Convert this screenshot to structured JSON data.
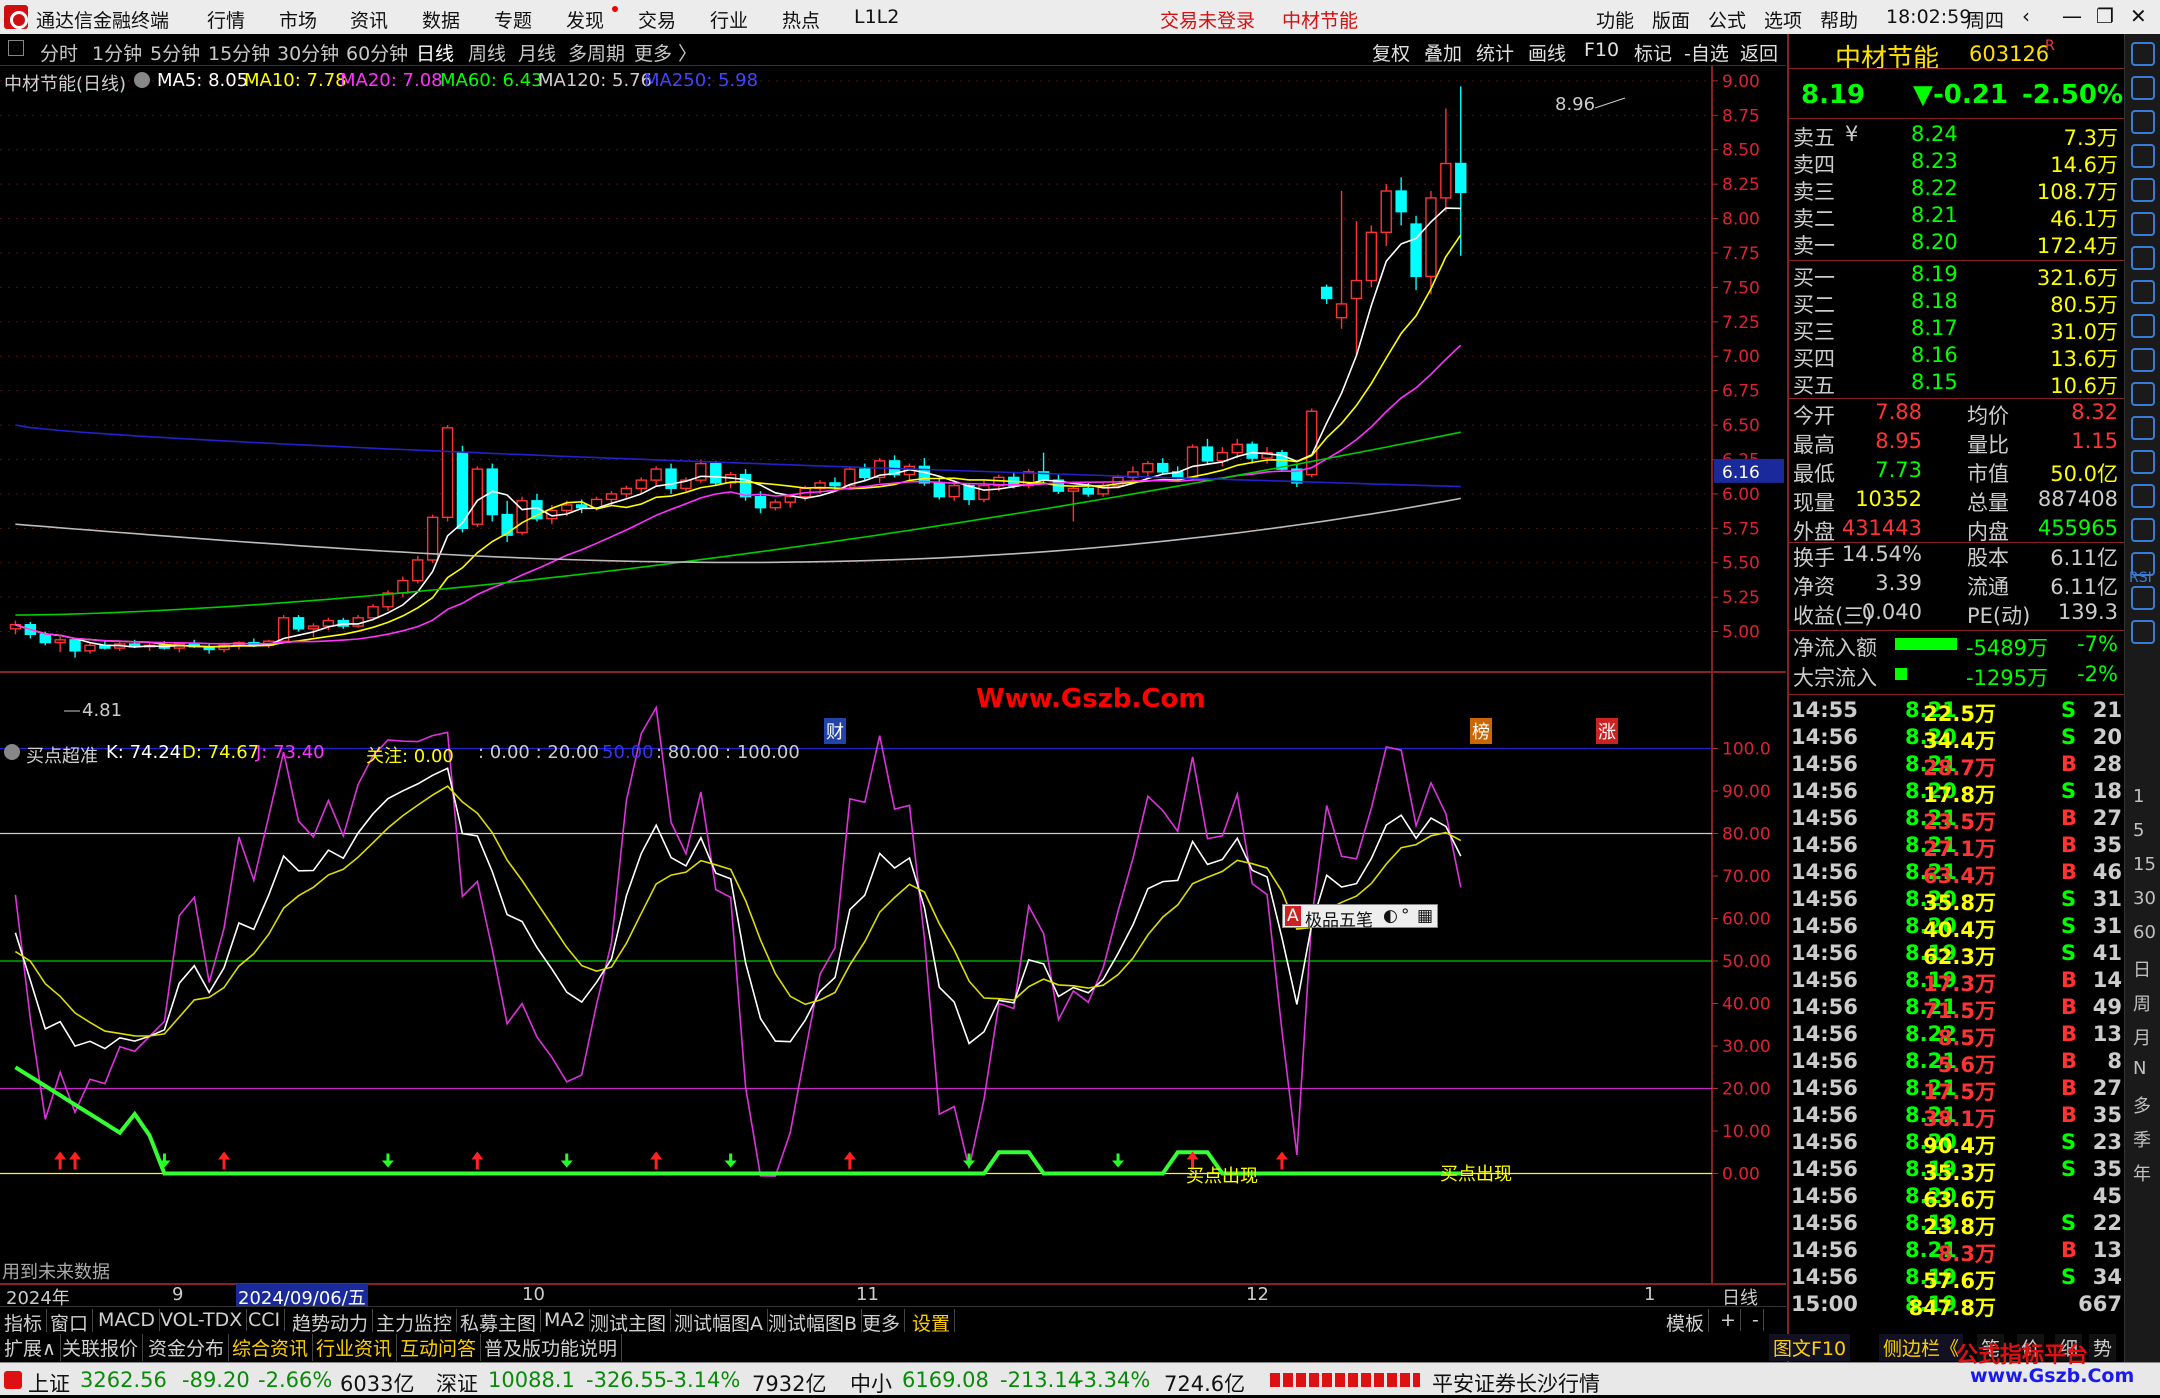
{
  "titlebar": {
    "app_title": "通达信金融终端",
    "menus": [
      "行情",
      "市场",
      "资讯",
      "数据",
      "专题",
      "发现",
      "交易",
      "行业",
      "热点",
      "L1L2"
    ],
    "login": "交易未登录",
    "stock": "中材节能",
    "right_menus": [
      "功能",
      "版面",
      "公式",
      "选项",
      "帮助"
    ],
    "time": "18:02:59",
    "weekday": "周四"
  },
  "toolbar": {
    "periods": [
      "分时",
      "1分钟",
      "5分钟",
      "15分钟",
      "30分钟",
      "60分钟",
      "日线",
      "周线",
      "月线",
      "多周期",
      "更多"
    ],
    "selected": "日线",
    "right": [
      "复权",
      "叠加",
      "统计",
      "画线",
      "F10",
      "标记",
      "-自选",
      "返回"
    ]
  },
  "main_chart": {
    "stock_period": "中材节能(日线)",
    "ma": [
      {
        "label": "MA5: 8.05",
        "color": "#ffffff"
      },
      {
        "label": "MA10: 7.78",
        "color": "#ffff00"
      },
      {
        "label": "MA20: 7.08",
        "color": "#ff33ff"
      },
      {
        "label": "MA60: 6.43",
        "color": "#00ff00"
      },
      {
        "label": "MA120: 5.76",
        "color": "#c0c0c0"
      },
      {
        "label": "MA250: 5.98",
        "color": "#3333ff"
      }
    ],
    "y_ticks": [
      "9.00",
      "8.75",
      "8.50",
      "8.25",
      "8.00",
      "7.75",
      "7.50",
      "7.25",
      "7.00",
      "6.75",
      "6.50",
      "6.25",
      "6.00",
      "5.75",
      "5.50",
      "5.25",
      "5.00"
    ],
    "high_label": "8.96",
    "low_label": "4.81",
    "current_price_tag": "6.16",
    "watermark": "Www.Gszb.Com",
    "markers": [
      "财",
      "榜",
      "涨"
    ]
  },
  "indicator": {
    "name": "买点超准",
    "k": "K: 74.24",
    "d": "D: 74.67",
    "j": "J: 73.40",
    "focus": "关注: 0.00",
    "levels": ": 0.00 : 20.00",
    "level50": "50.00",
    "levels2": ": 80.00 : 100.00",
    "y_ticks": [
      "100.0",
      "90.00",
      "80.00",
      "70.00",
      "60.00",
      "50.00",
      "40.00",
      "30.00",
      "20.00",
      "10.00",
      "0.00"
    ],
    "buy_signal": "买点出现",
    "popup_label": "极品五笔",
    "note": "用到未来数据"
  },
  "x_axis": {
    "labels": [
      "2024年",
      "9",
      "2024/09/06/五",
      "10",
      "11",
      "12",
      "1"
    ],
    "period": "日线"
  },
  "tabs_row1": [
    "指标",
    "窗口",
    "MACD",
    "VOL-TDX",
    "CCI",
    "趋势动力",
    "主力监控",
    "私募主图",
    "MA2",
    "测试主图",
    "测试幅图A",
    "测试幅图B",
    "更多",
    "设置"
  ],
  "tabs_row1_right": [
    "模板",
    "+",
    "-"
  ],
  "tabs_row2": [
    "扩展∧",
    "关联报价",
    "资金分布",
    "综合资讯",
    "行业资讯",
    "互动问答",
    "普及版功能说明"
  ],
  "panel": {
    "name": "中材节能",
    "code": "603126",
    "suffix": "R",
    "price": "8.19",
    "change": "▼-0.21",
    "change_pct": "-2.50%",
    "asks": [
      {
        "label": "卖五",
        "flag": "¥",
        "price": "8.24",
        "vol": "7.3万"
      },
      {
        "label": "卖四",
        "flag": "",
        "price": "8.23",
        "vol": "14.6万"
      },
      {
        "label": "卖三",
        "flag": "",
        "price": "8.22",
        "vol": "108.7万"
      },
      {
        "label": "卖二",
        "flag": "",
        "price": "8.21",
        "vol": "46.1万"
      },
      {
        "label": "卖一",
        "flag": "",
        "price": "8.20",
        "vol": "172.4万"
      }
    ],
    "bids": [
      {
        "label": "买一",
        "price": "8.19",
        "vol": "321.6万"
      },
      {
        "label": "买二",
        "price": "8.18",
        "vol": "80.5万"
      },
      {
        "label": "买三",
        "price": "8.17",
        "vol": "31.0万"
      },
      {
        "label": "买四",
        "price": "8.16",
        "vol": "13.6万"
      },
      {
        "label": "买五",
        "price": "8.15",
        "vol": "10.6万"
      }
    ],
    "stats1": [
      {
        "a": "今开",
        "b": "7.88",
        "c": "均价",
        "d": "8.32"
      },
      {
        "a": "最高",
        "b": "8.95",
        "c": "量比",
        "d": "1.15"
      },
      {
        "a": "最低",
        "b": "7.73",
        "c": "市值",
        "d": "50.0亿"
      },
      {
        "a": "现量",
        "b": "10352",
        "c": "总量",
        "d": "887408"
      },
      {
        "a": "外盘",
        "b": "431443",
        "c": "内盘",
        "d": "455965"
      }
    ],
    "stats2": [
      {
        "a": "换手",
        "b": "14.54%",
        "c": "股本",
        "d": "6.11亿"
      },
      {
        "a": "净资",
        "b": "3.39",
        "c": "流通",
        "d": "6.11亿"
      },
      {
        "a": "收益(三)",
        "b": "0.040",
        "c": "PE(动)",
        "d": "139.3"
      }
    ],
    "flows": [
      {
        "label": "净流入额",
        "value": "-5489万",
        "pct": "-7%",
        "bar": 0.62
      },
      {
        "label": "大宗流入",
        "value": "-1295万",
        "pct": "-2%",
        "bar": 0.12
      }
    ],
    "ticks": [
      {
        "t": "14:55",
        "p": "8.21",
        "v": "22.5万",
        "s": "S",
        "n": "21"
      },
      {
        "t": "14:56",
        "p": "8.20",
        "v": "34.4万",
        "s": "S",
        "n": "20"
      },
      {
        "t": "14:56",
        "p": "8.21",
        "v": "28.7万",
        "s": "B",
        "n": "28"
      },
      {
        "t": "14:56",
        "p": "8.20",
        "v": "17.8万",
        "s": "S",
        "n": "18"
      },
      {
        "t": "14:56",
        "p": "8.21",
        "v": "23.5万",
        "s": "B",
        "n": "27"
      },
      {
        "t": "14:56",
        "p": "8.21",
        "v": "27.1万",
        "s": "B",
        "n": "35"
      },
      {
        "t": "14:56",
        "p": "8.21",
        "v": "63.4万",
        "s": "B",
        "n": "46"
      },
      {
        "t": "14:56",
        "p": "8.20",
        "v": "35.8万",
        "s": "S",
        "n": "31"
      },
      {
        "t": "14:56",
        "p": "8.20",
        "v": "40.4万",
        "s": "S",
        "n": "31"
      },
      {
        "t": "14:56",
        "p": "8.19",
        "v": "62.3万",
        "s": "S",
        "n": "41"
      },
      {
        "t": "14:56",
        "p": "8.19",
        "v": "17.3万",
        "s": "B",
        "n": "14"
      },
      {
        "t": "14:56",
        "p": "8.21",
        "v": "71.5万",
        "s": "B",
        "n": "49"
      },
      {
        "t": "14:56",
        "p": "8.22",
        "v": "8.5万",
        "s": "B",
        "n": "13"
      },
      {
        "t": "14:56",
        "p": "8.21",
        "v": "5.6万",
        "s": "B",
        "n": "8"
      },
      {
        "t": "14:56",
        "p": "8.21",
        "v": "17.5万",
        "s": "B",
        "n": "27"
      },
      {
        "t": "14:56",
        "p": "8.21",
        "v": "38.1万",
        "s": "B",
        "n": "35"
      },
      {
        "t": "14:56",
        "p": "8.20",
        "v": "90.4万",
        "s": "S",
        "n": "23"
      },
      {
        "t": "14:56",
        "p": "8.19",
        "v": "35.3万",
        "s": "S",
        "n": "35"
      },
      {
        "t": "14:56",
        "p": "8.20",
        "v": "63.6万",
        "s": "",
        "n": "45"
      },
      {
        "t": "14:56",
        "p": "8.19",
        "v": "23.8万",
        "s": "S",
        "n": "22"
      },
      {
        "t": "14:56",
        "p": "8.21",
        "v": "8.3万",
        "s": "B",
        "n": "13"
      },
      {
        "t": "14:56",
        "p": "8.19",
        "v": "57.6万",
        "s": "S",
        "n": "34"
      },
      {
        "t": "15:00",
        "p": "8.19",
        "v": "847.8万",
        "s": "",
        "n": "667"
      }
    ],
    "bottom_tabs": [
      "图文F10",
      "侧边栏《",
      "笔",
      "价",
      "细",
      "势"
    ]
  },
  "rbar_text": [
    "RSI",
    "1",
    "5",
    "15",
    "30",
    "60",
    "日",
    "周",
    "月",
    "N",
    "多",
    "季",
    "年"
  ],
  "status": {
    "sh_label": "上证",
    "sh_val": "3262.56",
    "sh_chg": "-89.20",
    "sh_pct": "-2.66%",
    "sh_amt": "6033亿",
    "sz_label": "深证",
    "sz_val": "10088.1",
    "sz_chg": "-326.55",
    "sz_pct": "-3.14%",
    "sz_amt": "7932亿",
    "zx_label": "中小",
    "zx_val": "6169.08",
    "zx_chg": "-213.14",
    "zx_pct": "-3.34%",
    "zx_amt": "724.6亿",
    "broker": "平安证券长沙行情",
    "brand": "公式指标平台",
    "brand_url": "www.Gszb.Com"
  },
  "chart_data": {
    "type": "candlestick",
    "y_range": [
      4.75,
      9.05
    ],
    "candles": [
      [
        5.02,
        5.08,
        4.98,
        5.05
      ],
      [
        5.05,
        5.07,
        4.95,
        4.98
      ],
      [
        4.98,
        5.0,
        4.9,
        4.92
      ],
      [
        4.92,
        4.96,
        4.85,
        4.94
      ],
      [
        4.94,
        4.95,
        4.81,
        4.86
      ],
      [
        4.86,
        4.92,
        4.84,
        4.9
      ],
      [
        4.9,
        4.94,
        4.87,
        4.88
      ],
      [
        4.88,
        4.93,
        4.86,
        4.91
      ],
      [
        4.91,
        4.94,
        4.88,
        4.89
      ],
      [
        4.89,
        4.92,
        4.86,
        4.9
      ],
      [
        4.9,
        4.93,
        4.87,
        4.88
      ],
      [
        4.88,
        4.92,
        4.85,
        4.91
      ],
      [
        4.91,
        4.94,
        4.88,
        4.89
      ],
      [
        4.89,
        4.91,
        4.84,
        4.87
      ],
      [
        4.87,
        4.92,
        4.85,
        4.9
      ],
      [
        4.9,
        4.93,
        4.87,
        4.92
      ],
      [
        4.92,
        4.95,
        4.89,
        4.9
      ],
      [
        4.9,
        4.94,
        4.88,
        4.93
      ],
      [
        4.93,
        5.12,
        4.92,
        5.1
      ],
      [
        5.1,
        5.12,
        5.0,
        5.02
      ],
      [
        5.02,
        5.06,
        4.96,
        5.04
      ],
      [
        5.04,
        5.1,
        5.01,
        5.08
      ],
      [
        5.08,
        5.1,
        5.02,
        5.04
      ],
      [
        5.04,
        5.12,
        5.03,
        5.1
      ],
      [
        5.1,
        5.2,
        5.08,
        5.18
      ],
      [
        5.18,
        5.3,
        5.15,
        5.28
      ],
      [
        5.28,
        5.4,
        5.25,
        5.37
      ],
      [
        5.37,
        5.55,
        5.35,
        5.52
      ],
      [
        5.52,
        5.85,
        5.5,
        5.83
      ],
      [
        5.83,
        6.5,
        5.8,
        6.48
      ],
      [
        6.3,
        6.35,
        5.72,
        5.75
      ],
      [
        5.78,
        6.2,
        5.76,
        6.18
      ],
      [
        6.18,
        6.22,
        5.8,
        5.85
      ],
      [
        5.85,
        5.95,
        5.65,
        5.7
      ],
      [
        5.72,
        5.98,
        5.7,
        5.95
      ],
      [
        5.95,
        6.0,
        5.8,
        5.82
      ],
      [
        5.82,
        5.92,
        5.78,
        5.88
      ],
      [
        5.88,
        5.95,
        5.84,
        5.92
      ],
      [
        5.92,
        5.96,
        5.86,
        5.9
      ],
      [
        5.9,
        5.98,
        5.88,
        5.96
      ],
      [
        5.96,
        6.02,
        5.92,
        6.0
      ],
      [
        6.0,
        6.06,
        5.96,
        6.04
      ],
      [
        6.04,
        6.12,
        6.0,
        6.1
      ],
      [
        6.1,
        6.2,
        6.05,
        6.18
      ],
      [
        6.18,
        6.22,
        6.0,
        6.04
      ],
      [
        6.04,
        6.12,
        6.02,
        6.1
      ],
      [
        6.1,
        6.25,
        6.08,
        6.22
      ],
      [
        6.22,
        6.24,
        6.06,
        6.08
      ],
      [
        6.08,
        6.16,
        6.04,
        6.14
      ],
      [
        6.14,
        6.18,
        5.95,
        5.98
      ],
      [
        5.98,
        6.02,
        5.86,
        5.9
      ],
      [
        5.9,
        5.96,
        5.88,
        5.94
      ],
      [
        5.94,
        6.0,
        5.9,
        5.98
      ],
      [
        5.98,
        6.06,
        5.95,
        6.04
      ],
      [
        6.04,
        6.1,
        6.0,
        6.08
      ],
      [
        6.08,
        6.12,
        6.02,
        6.06
      ],
      [
        6.06,
        6.2,
        6.04,
        6.18
      ],
      [
        6.18,
        6.22,
        6.1,
        6.12
      ],
      [
        6.12,
        6.26,
        6.08,
        6.24
      ],
      [
        6.24,
        6.28,
        6.12,
        6.14
      ],
      [
        6.14,
        6.22,
        6.1,
        6.2
      ],
      [
        6.2,
        6.26,
        6.06,
        6.08
      ],
      [
        6.08,
        6.12,
        5.96,
        5.98
      ],
      [
        5.98,
        6.1,
        5.95,
        6.06
      ],
      [
        6.06,
        6.08,
        5.92,
        5.96
      ],
      [
        5.96,
        6.1,
        5.94,
        6.06
      ],
      [
        6.06,
        6.14,
        6.02,
        6.12
      ],
      [
        6.12,
        6.16,
        6.04,
        6.06
      ],
      [
        6.06,
        6.18,
        6.04,
        6.16
      ],
      [
        6.16,
        6.3,
        6.08,
        6.1
      ],
      [
        6.1,
        6.14,
        6.0,
        6.02
      ],
      [
        6.02,
        6.06,
        5.8,
        6.04
      ],
      [
        6.04,
        6.08,
        5.98,
        6.0
      ],
      [
        6.0,
        6.08,
        5.98,
        6.06
      ],
      [
        6.06,
        6.14,
        6.04,
        6.12
      ],
      [
        6.12,
        6.2,
        6.08,
        6.16
      ],
      [
        6.16,
        6.24,
        6.12,
        6.22
      ],
      [
        6.22,
        6.26,
        6.14,
        6.16
      ],
      [
        6.16,
        6.2,
        6.1,
        6.12
      ],
      [
        6.12,
        6.36,
        6.1,
        6.34
      ],
      [
        6.34,
        6.4,
        6.22,
        6.24
      ],
      [
        6.24,
        6.34,
        6.2,
        6.3
      ],
      [
        6.3,
        6.4,
        6.26,
        6.36
      ],
      [
        6.36,
        6.38,
        6.22,
        6.26
      ],
      [
        6.26,
        6.34,
        6.22,
        6.3
      ],
      [
        6.3,
        6.32,
        6.16,
        6.18
      ],
      [
        6.18,
        6.22,
        6.05,
        6.08
      ],
      [
        6.14,
        6.62,
        6.12,
        6.6
      ],
      [
        7.5,
        7.52,
        7.38,
        7.42
      ],
      [
        7.28,
        8.2,
        7.2,
        7.38
      ],
      [
        7.42,
        7.98,
        7.0,
        7.55
      ],
      [
        7.55,
        7.95,
        7.5,
        7.9
      ],
      [
        7.9,
        8.25,
        7.8,
        8.2
      ],
      [
        8.2,
        8.3,
        7.95,
        8.05
      ],
      [
        7.96,
        8.02,
        7.48,
        7.58
      ],
      [
        7.58,
        8.2,
        7.45,
        8.15
      ],
      [
        8.15,
        8.8,
        8.05,
        8.4
      ],
      [
        8.4,
        8.96,
        7.73,
        8.19
      ]
    ]
  }
}
